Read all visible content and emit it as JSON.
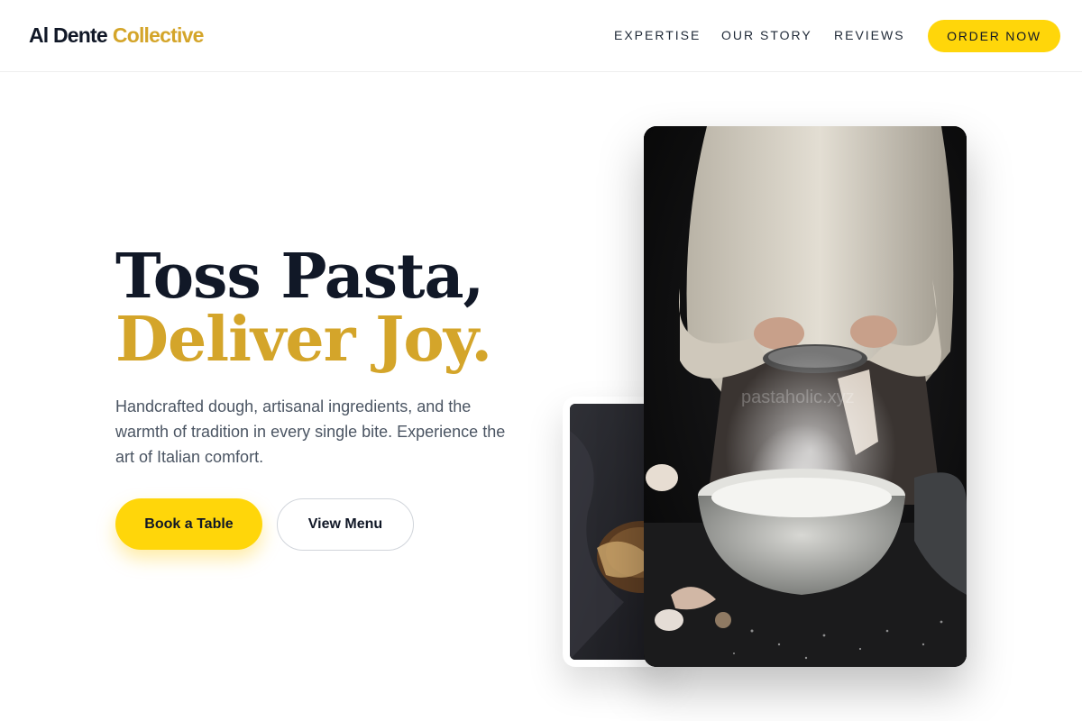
{
  "header": {
    "logo_main": "Al Dente",
    "logo_accent": "Collective",
    "nav": [
      "EXPERTISE",
      "OUR STORY",
      "REVIEWS"
    ],
    "cta": "ORDER NOW"
  },
  "hero": {
    "title_line1": "Toss Pasta,",
    "title_line2": "Deliver Joy.",
    "subtitle": "Handcrafted dough, artisanal ingredients, and the warmth of tradition in every single bite. Experience the art of Italian comfort.",
    "primary_button": "Book a Table",
    "secondary_button": "View Menu"
  },
  "images": {
    "main_watermark": "pastaholic.xyz"
  },
  "colors": {
    "accent_gold": "#d4a52a",
    "button_yellow": "#ffd60a",
    "text_dark": "#111827"
  }
}
